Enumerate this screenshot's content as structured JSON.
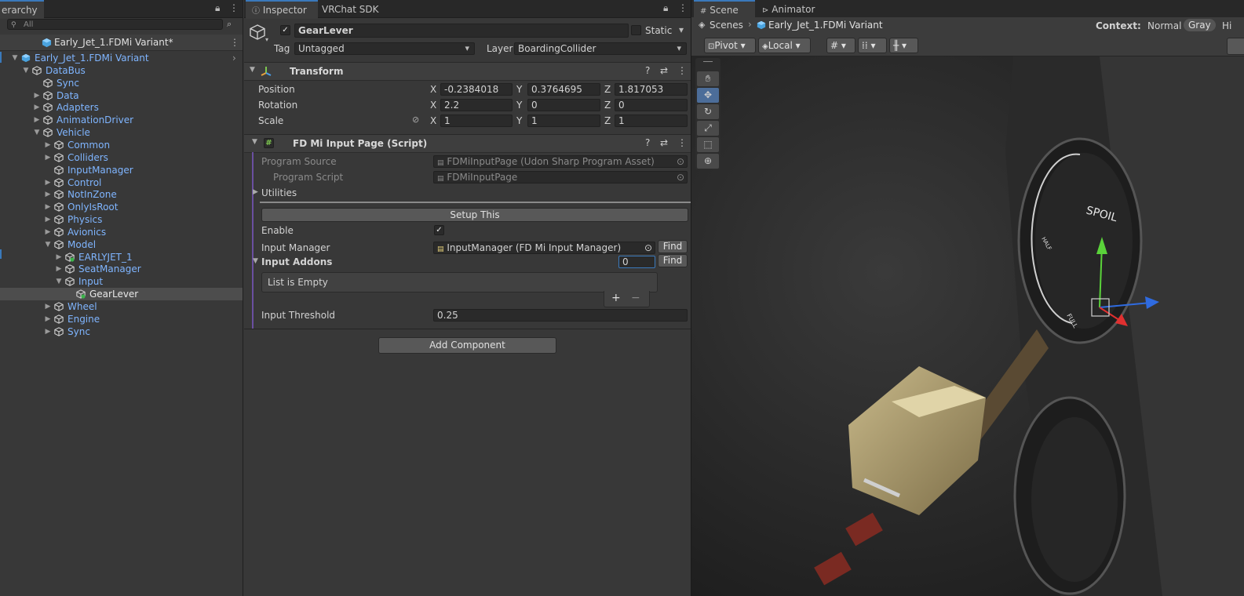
{
  "hierarchy": {
    "tab_label": "erarchy",
    "search_placeholder": "All",
    "scene_name": "Early_Jet_1.FDMi Variant*",
    "items": [
      {
        "label": "Early_Jet_1.FDMi Variant",
        "depth": 0,
        "arrow": "▼"
      },
      {
        "label": "DataBus",
        "depth": 1,
        "arrow": "▼"
      },
      {
        "label": "Sync",
        "depth": 2,
        "arrow": ""
      },
      {
        "label": "Data",
        "depth": 2,
        "arrow": "▶"
      },
      {
        "label": "Adapters",
        "depth": 2,
        "arrow": "▶"
      },
      {
        "label": "AnimationDriver",
        "depth": 2,
        "arrow": "▶"
      },
      {
        "label": "Vehicle",
        "depth": 2,
        "arrow": "▼"
      },
      {
        "label": "Common",
        "depth": 3,
        "arrow": "▶"
      },
      {
        "label": "Colliders",
        "depth": 3,
        "arrow": "▶"
      },
      {
        "label": "InputManager",
        "depth": 3,
        "arrow": ""
      },
      {
        "label": "Control",
        "depth": 3,
        "arrow": "▶"
      },
      {
        "label": "NotInZone",
        "depth": 3,
        "arrow": "▶"
      },
      {
        "label": "OnlyIsRoot",
        "depth": 3,
        "arrow": "▶"
      },
      {
        "label": "Physics",
        "depth": 3,
        "arrow": "▶"
      },
      {
        "label": "Avionics",
        "depth": 3,
        "arrow": "▶"
      },
      {
        "label": "Model",
        "depth": 3,
        "arrow": "▼"
      },
      {
        "label": "EARLYJET_1",
        "depth": 4,
        "arrow": "▶"
      },
      {
        "label": "SeatManager",
        "depth": 4,
        "arrow": "▶"
      },
      {
        "label": "Input",
        "depth": 4,
        "arrow": "▼"
      },
      {
        "label": "GearLever",
        "depth": 5,
        "arrow": "",
        "selected": true
      },
      {
        "label": "Wheel",
        "depth": 3,
        "arrow": "▶"
      },
      {
        "label": "Engine",
        "depth": 3,
        "arrow": "▶"
      },
      {
        "label": "Sync",
        "depth": 3,
        "arrow": "▶"
      }
    ]
  },
  "inspector": {
    "tabs": [
      "Inspector",
      "VRChat SDK"
    ],
    "object_name": "GearLever",
    "static_label": "Static",
    "tag_label": "Tag",
    "tag_value": "Untagged",
    "layer_label": "Layer",
    "layer_value": "BoardingCollider",
    "transform": {
      "title": "Transform",
      "position_label": "Position",
      "rotation_label": "Rotation",
      "scale_label": "Scale",
      "position": {
        "x": "-0.2384018",
        "y": "0.3764695",
        "z": "1.817053"
      },
      "rotation": {
        "x": "2.2",
        "y": "0",
        "z": "0"
      },
      "scale": {
        "x": "1",
        "y": "1",
        "z": "1"
      },
      "axis_x": "X",
      "axis_y": "Y",
      "axis_z": "Z"
    },
    "script": {
      "title": "FD Mi Input Page (Script)",
      "program_source_label": "Program Source",
      "program_source_value": "FDMiInputPage (Udon Sharp Program Asset)",
      "program_script_label": "Program Script",
      "program_script_value": "FDMiInputPage",
      "utilities_label": "Utilities",
      "setup_button": "Setup This",
      "enable_label": "Enable",
      "input_manager_label": "Input Manager",
      "input_manager_value": "InputManager (FD Mi Input Manager)",
      "find_label": "Find",
      "input_addons_label": "Input Addons",
      "input_addons_count": "0",
      "list_empty": "List is Empty",
      "plus": "+",
      "minus": "−",
      "input_threshold_label": "Input Threshold",
      "input_threshold_value": "0.25"
    },
    "add_component": "Add Component"
  },
  "scene": {
    "tabs": [
      "Scene",
      "Animator"
    ],
    "breadcrumb_root": "Scenes",
    "breadcrumb_item": "Early_Jet_1.FDMi Variant",
    "context_label": "Context:",
    "context_normal": "Normal",
    "context_gray": "Gray",
    "context_hidden": "Hi",
    "pivot_label": "Pivot",
    "local_label": "Local",
    "gauge_text": "SPOIL",
    "gauge_half": "HALF",
    "gauge_full": "FULL"
  },
  "colors": {
    "accent": "#3a79bb",
    "hier_text": "#7fb5ff",
    "panel": "#383838"
  }
}
